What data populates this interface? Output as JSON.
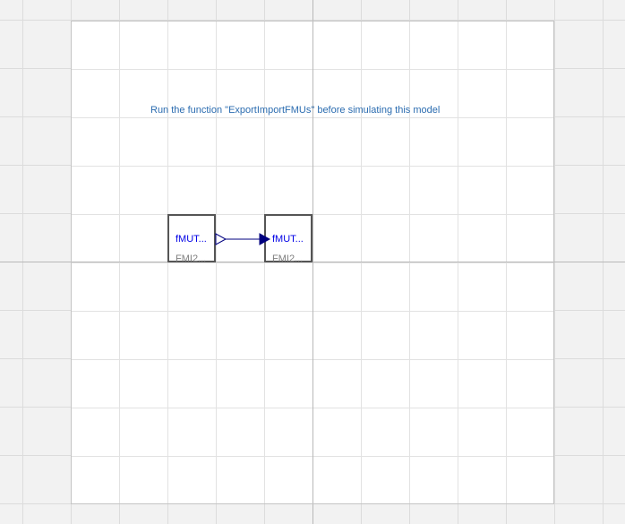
{
  "diagram": {
    "annotation": "Run the function \"ExportImportFMUs\" before simulating this model",
    "components": [
      {
        "name": "fMUT...",
        "type": "FMI2..."
      },
      {
        "name": "fMUT...",
        "type": "FMI2..."
      }
    ],
    "connection": {
      "from": "fMUT...",
      "to": "fMUT..."
    },
    "colors": {
      "annotation": "#2b6cb0",
      "component_name": "#0000e6",
      "component_type": "#808080",
      "connector": "#00007f",
      "block_border": "#555555"
    }
  }
}
